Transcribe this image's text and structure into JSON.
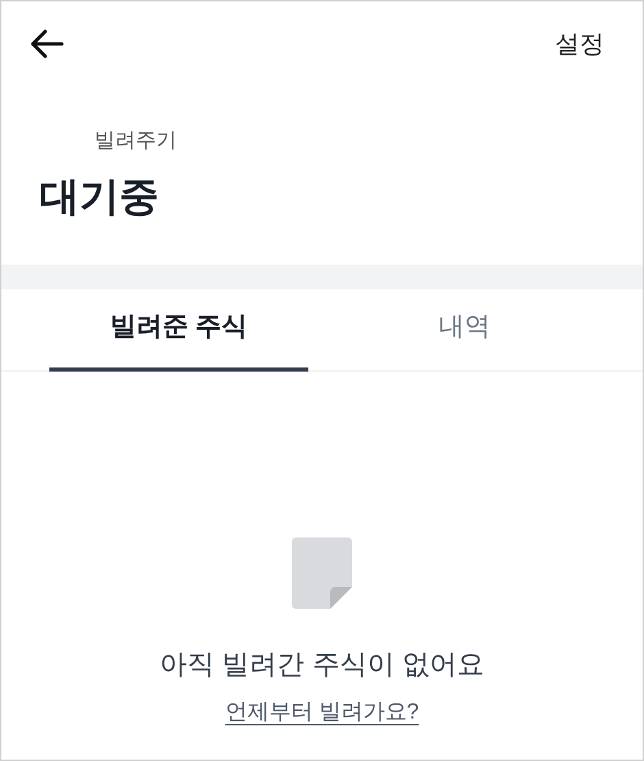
{
  "header": {
    "action": "설정"
  },
  "subtitle": "빌려주기",
  "title": "대기중",
  "tabs": [
    {
      "label": "빌려준 주식",
      "selected": true
    },
    {
      "label": "내역",
      "selected": false
    }
  ],
  "empty_state": {
    "message": "아직 빌려간 주식이 없어요",
    "link": "언제부터 빌려가요?"
  }
}
